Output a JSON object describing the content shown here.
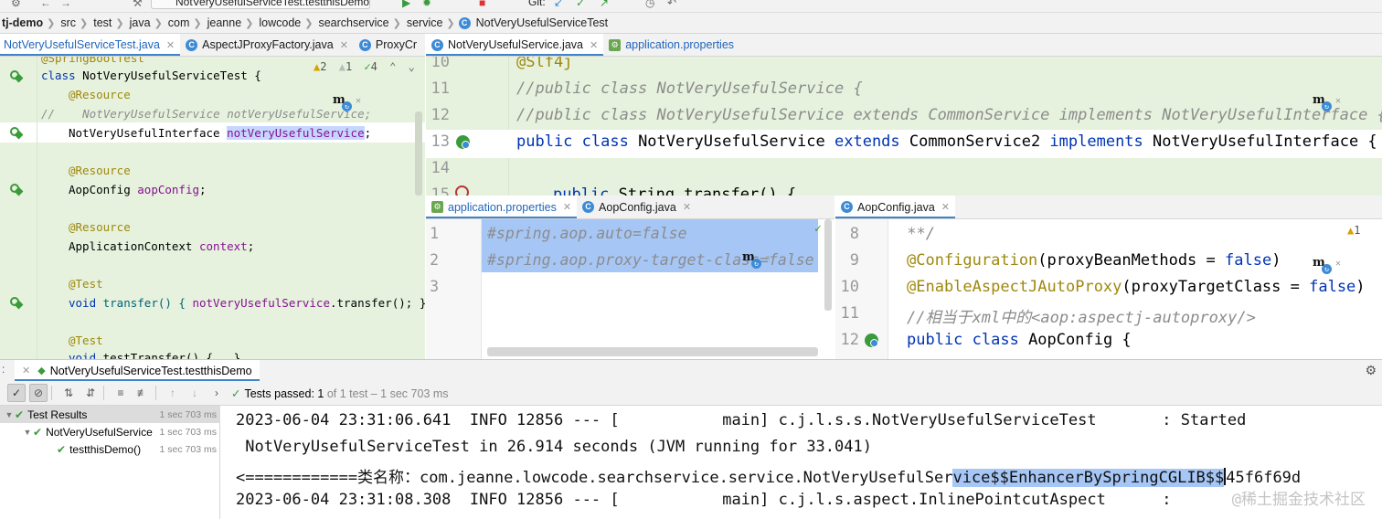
{
  "toolbar": {
    "run_config": "NotVeryUsefulServiceTest.testthisDemo",
    "git_label": "Git:"
  },
  "breadcrumb": {
    "items": [
      "tj-demo",
      "src",
      "test",
      "java",
      "com",
      "jeanne",
      "lowcode",
      "searchservice",
      "service",
      "NotVeryUsefulServiceTest"
    ]
  },
  "left_tabs": [
    "NotVeryUsefulServiceTest.java",
    "AspectJProxyFactory.java",
    "ProxyCr"
  ],
  "right_top_tabs": [
    "NotVeryUsefulService.java",
    "application.properties"
  ],
  "mid_tabs": [
    "application.properties",
    "AopConfig.java"
  ],
  "right_bottom_tabs": [
    "AopConfig.java"
  ],
  "left_editor": {
    "inspections": {
      "warnings": "2",
      "weak": "1",
      "ok": "4"
    },
    "lines": {
      "l0": "@SpringBootTest",
      "l1_kw": "class",
      "l1_rest": " NotVeryUsefulServiceTest {",
      "l2": "@Resource",
      "l3": "//    NotVeryUsefulService notVeryUsefulService;",
      "l4_type": "NotVeryUsefulInterface ",
      "l4_field": "notVeryUsefulService",
      "l4_end": ";",
      "l5": "@Resource",
      "l6_type": "AopConfig ",
      "l6_field": "aopConfig",
      "l6_end": ";",
      "l7": "@Resource",
      "l8_type": "ApplicationContext ",
      "l8_field": "context",
      "l8_end": ";",
      "l9": "@Test",
      "l10_kw": "void",
      "l10_name": " transfer() { ",
      "l10_field": "notVeryUsefulService",
      "l10_end": ".transfer(); }",
      "l11": "@Test",
      "l12_kw": "void",
      "l12_rest": " testTransfer() {...}"
    }
  },
  "service_editor": {
    "line_numbers": [
      "10",
      "11",
      "12",
      "13",
      "14",
      "15"
    ],
    "lines": {
      "l10": "@Slf4j",
      "l11": "//public class NotVeryUsefulService {",
      "l12": "//public class NotVeryUsefulService extends CommonService implements NotVeryUsefulInterface {",
      "l13_kw1": "public class",
      "l13_name": " NotVeryUsefulService ",
      "l13_kw2": "extends",
      "l13_mid": " CommonService2 ",
      "l13_kw3": "implements",
      "l13_end": " NotVeryUsefulInterface {",
      "l15_kw": "public",
      "l15_rest": " String transfer() {"
    }
  },
  "properties_editor": {
    "line_numbers": [
      "1",
      "2",
      "3"
    ],
    "lines": {
      "l1": "#spring.aop.auto=false",
      "l2": "#spring.aop.proxy-target-class=false"
    }
  },
  "aopconfig_editor": {
    "inspections": {
      "warnings": "1"
    },
    "line_numbers": [
      "8",
      "9",
      "10",
      "11",
      "12"
    ],
    "lines": {
      "l8": " **/",
      "l9_ann": "@Configuration",
      "l9_mid": "(proxyBeanMethods = ",
      "l9_kw": "false",
      "l9_end": ")",
      "l10_ann": "@EnableAspectJAutoProxy",
      "l10_mid": "(proxyTargetClass = ",
      "l10_kw": "false",
      "l10_end": ")",
      "l11": "//相当于xml中的<aop:aspectj-autoproxy/>",
      "l12_kw": "public class",
      "l12_rest": " AopConfig {"
    }
  },
  "run_panel": {
    "tab_label": "NotVeryUsefulServiceTest.testthisDemo",
    "status_prefix": "Tests passed: ",
    "status_count": "1",
    "status_rest": " of 1 test – 1 sec 703 ms",
    "tree": [
      {
        "label": "Test Results",
        "time": "1 sec 703 ms"
      },
      {
        "label": "NotVeryUsefulService",
        "time": "1 sec 703 ms"
      },
      {
        "label": "testthisDemo()",
        "time": "1 sec 703 ms"
      }
    ]
  },
  "console": {
    "line1": "2023-06-04 23:31:06.641  INFO 12856 --- [           main] c.j.l.s.s.NotVeryUsefulServiceTest       : Started",
    "line2": " NotVeryUsefulServiceTest in 26.914 seconds (JVM running for 33.041)",
    "line3_pre": "<============类名称：com.jeanne.lowcode.searchservice.service.NotVeryUsefulSer",
    "line3_sel": "vice$$EnhancerBySpringCGLIB$$",
    "line3_post": "45f6f69d",
    "line4": "2023-06-04 23:31:08.308  INFO 12856 --- [           main] c.j.l.s.aspect.InlinePointcutAspect      :",
    "watermark": "@稀土掘金技术社区"
  }
}
